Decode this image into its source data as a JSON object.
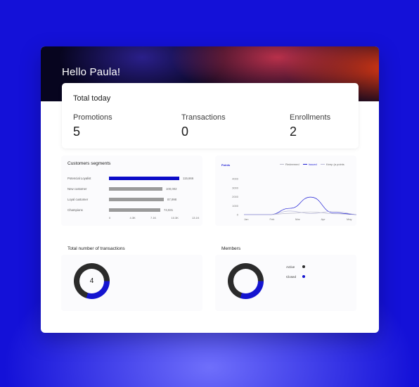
{
  "header": {
    "greeting": "Hello Paula!"
  },
  "totals": {
    "title": "Total today",
    "items": [
      {
        "label": "Promotions",
        "value": "5"
      },
      {
        "label": "Transactions",
        "value": "0"
      },
      {
        "label": "Enrollments",
        "value": "2"
      }
    ]
  },
  "segments": {
    "title": "Customers segments",
    "rows": [
      {
        "label": "Potencial Loyalist",
        "value": "115,666",
        "fraction": 1.0,
        "color": "#0c0cc8"
      },
      {
        "label": "New customer",
        "value": "100,002",
        "fraction": 0.76,
        "color": "#9a9a9a"
      },
      {
        "label": "Loyal customer",
        "value": "87,998",
        "fraction": 0.78,
        "color": "#9a9a9a"
      },
      {
        "label": "Champions",
        "value": "74,931",
        "fraction": 0.73,
        "color": "#9a9a9a"
      }
    ],
    "ticks": [
      "0",
      "4.3K",
      "7.1K",
      "10.3K",
      "13.1K"
    ]
  },
  "chart_data": {
    "type": "line",
    "title": "Points",
    "x": [
      "Jan",
      "Feb",
      "Mar",
      "Apr",
      "May"
    ],
    "yticks": [
      "4000",
      "3000",
      "2000",
      "1000",
      "0"
    ],
    "ylim": [
      0,
      4000
    ],
    "legend": [
      "Redeemed",
      "Issued",
      "Keep (a points"
    ],
    "series": [
      {
        "name": "Redeemed",
        "color": "#b8b8c8",
        "values": [
          0,
          0,
          0,
          150,
          300,
          100,
          0
        ]
      },
      {
        "name": "Issued",
        "color": "#1a1ad4",
        "values": [
          0,
          0,
          0,
          700,
          1950,
          200,
          0
        ]
      },
      {
        "name": "Keep (a points",
        "color": "#b8b8d6",
        "values": [
          0,
          0,
          0,
          400,
          120,
          350,
          0
        ]
      }
    ],
    "x_positions": [
      0,
      0.5,
      1,
      1.8,
      2.6,
      3.5,
      4.5
    ]
  },
  "transactions": {
    "title": "Total number of transactions",
    "value": "4",
    "blue_fraction": 0.3
  },
  "members": {
    "title": "Members",
    "legend": [
      {
        "label": "Active",
        "color": "#2b2b2b"
      },
      {
        "label": "Closed",
        "color": "#1414d0"
      }
    ],
    "blue_fraction": 0.3
  }
}
